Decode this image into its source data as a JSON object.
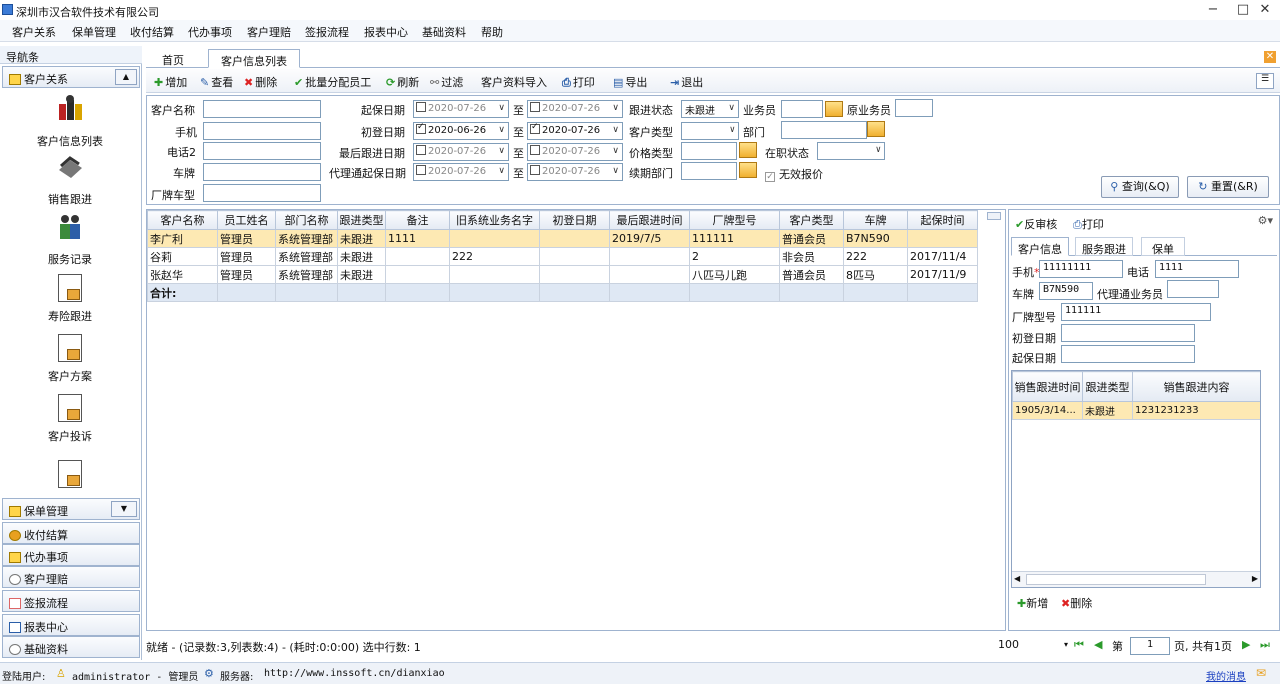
{
  "window": {
    "title": "深圳市汉合软件技术有限公司",
    "minimize": "−",
    "maximize": "□",
    "close": "✕"
  },
  "menu": [
    "客户关系",
    "保单管理",
    "收付结算",
    "代办事项",
    "客户理赔",
    "签报流程",
    "报表中心",
    "基础资料",
    "帮助"
  ],
  "nav": {
    "title": "导航条",
    "top_group": "客户关系",
    "items": [
      "客户信息列表",
      "销售跟进",
      "服务记录",
      "寿险跟进",
      "客户方案",
      "客户投诉"
    ],
    "groups": [
      "保单管理",
      "收付结算",
      "代办事项",
      "客户理赔",
      "签报流程",
      "报表中心",
      "基础资料"
    ]
  },
  "tabs": [
    "首页",
    "客户信息列表"
  ],
  "toolbar": {
    "add": "增加",
    "view": "查看",
    "delete": "删除",
    "assign": "批量分配员工",
    "refresh": "刷新",
    "filter": "过滤",
    "import": "客户资料导入",
    "print": "打印",
    "export": "导出",
    "exit": "退出"
  },
  "filter": {
    "customer_name": "客户名称",
    "mobile": "手机",
    "phone2": "电话2",
    "plate": "车牌",
    "model": "厂牌车型",
    "insure_date": "起保日期",
    "register_date": "初登日期",
    "last_follow": "最后跟进日期",
    "agent_insure": "代理通起保日期",
    "to": "至",
    "insure_from": "2020-07-26",
    "insure_to": "2020-07-26",
    "register_from": "2020-06-26",
    "register_to": "2020-07-26",
    "follow_from": "2020-07-26",
    "follow_to": "2020-07-26",
    "agent_from": "2020-07-26",
    "agent_to": "2020-07-26",
    "follow_status": "跟进状态",
    "follow_status_val": "未跟进",
    "customer_type": "客户类型",
    "price_type": "价格类型",
    "renew_dept": "续期部门",
    "salesman": "业务员",
    "orig_salesman": "原业务员",
    "dept": "部门",
    "employed": "在职状态",
    "invalid_quote": "无效报价",
    "query_btn": "查询(&Q)",
    "reset_btn": "重置(&R)"
  },
  "grid": {
    "columns": [
      "客户名称",
      "员工姓名",
      "部门名称",
      "跟进类型",
      "备注",
      "旧系统业务名字",
      "初登日期",
      "最后跟进时间",
      "厂牌型号",
      "客户类型",
      "车牌",
      "起保时间"
    ],
    "rows": [
      [
        "李广利",
        "管理员",
        "系统管理部",
        "未跟进",
        "1111",
        "",
        "",
        "2019/7/5",
        "111111",
        "普通会员",
        "B7N590",
        ""
      ],
      [
        "谷莉",
        "管理员",
        "系统管理部",
        "未跟进",
        "",
        "222",
        "",
        "",
        "2",
        "非会员",
        "222",
        "2017/11/4"
      ],
      [
        "张赵华",
        "管理员",
        "系统管理部",
        "未跟进",
        "",
        "",
        "",
        "",
        "八匹马儿跑",
        "普通会员",
        "8匹马",
        "2017/11/9"
      ]
    ],
    "total_label": "合计:"
  },
  "right": {
    "unaudit": "反审核",
    "print": "打印",
    "tabs": [
      "客户信息",
      "服务跟进",
      "保单"
    ],
    "mobile_label": "手机",
    "mobile_val": "11111111",
    "phone_label": "电话",
    "phone_val": "1111",
    "plate_label": "车牌",
    "plate_val": "B7N590",
    "agent_label": "代理通业务员",
    "model_label": "厂牌型号",
    "model_val": "111111",
    "register_label": "初登日期",
    "insure_label": "起保日期",
    "sub_columns": [
      "销售跟进时间",
      "跟进类型",
      "销售跟进内容"
    ],
    "sub_rows": [
      [
        "1905/3/14...",
        "未跟进",
        "1231231233"
      ]
    ],
    "new_btn": "新增",
    "del_btn": "删除"
  },
  "status": {
    "text": "就绪 - (记录数:3,列表数:4) - (耗时:0:0:00) 选中行数: 1",
    "page_size": "100",
    "page_prefix": "第",
    "page_num": "1",
    "page_suffix": "页, 共有1页"
  },
  "bottom": {
    "user_label": "登陆用户:",
    "user": "administrator - 管理员",
    "server_label": "服务器:",
    "server": "http://www.inssoft.cn/dianxiao",
    "msg": "我的消息"
  }
}
